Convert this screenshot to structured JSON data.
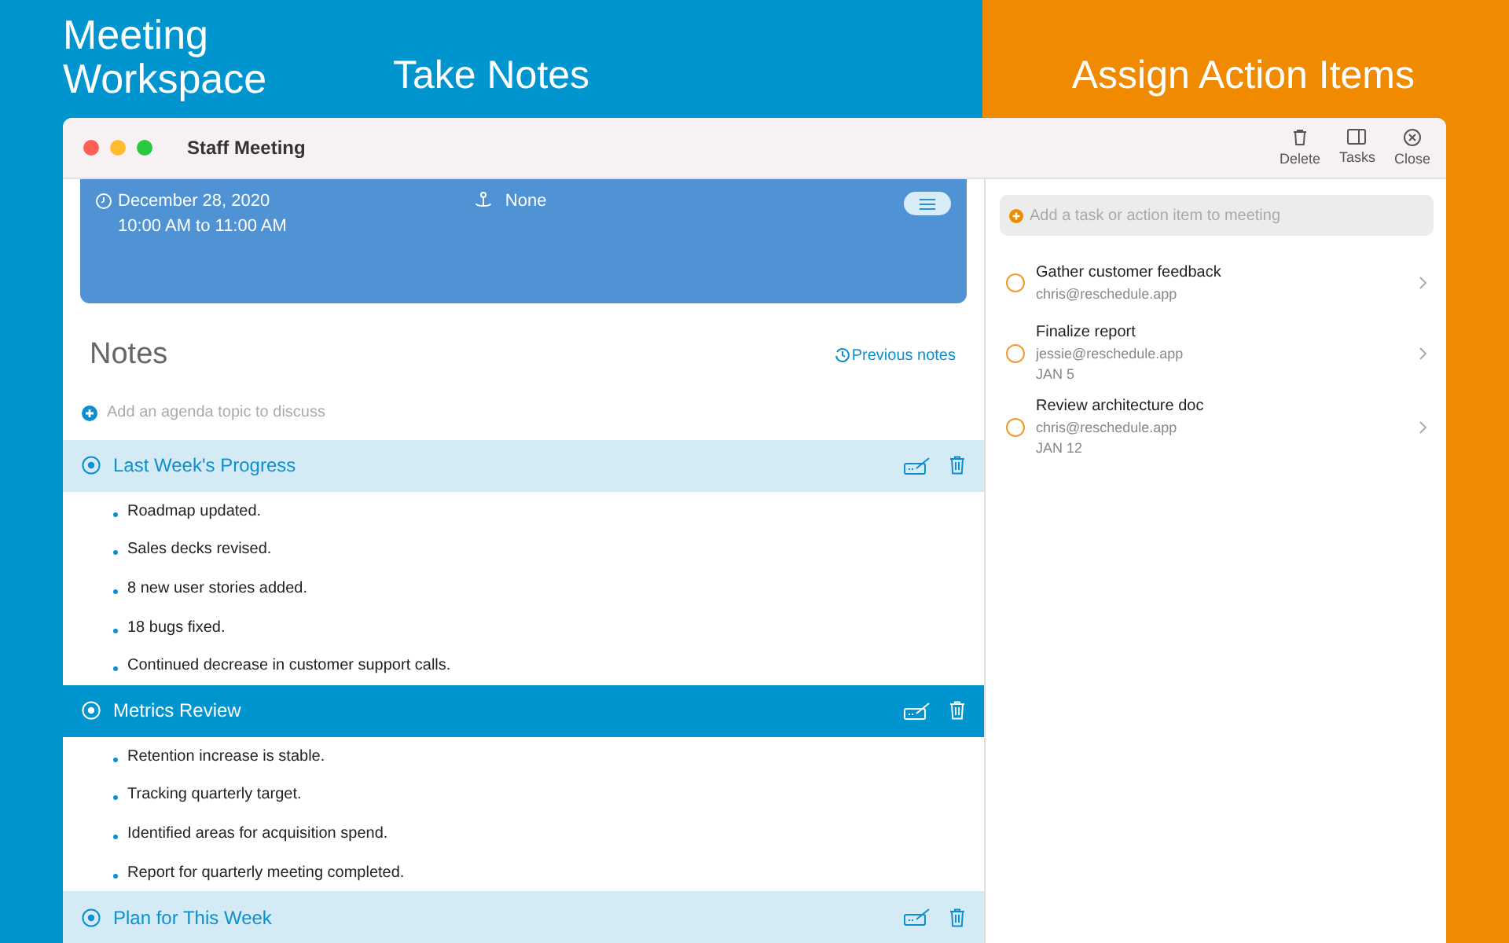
{
  "banner": {
    "app_title": "Meeting Workspace",
    "left_caption": "Take Notes",
    "right_caption": "Assign Action Items"
  },
  "window": {
    "title": "Staff Meeting",
    "toolbar": [
      {
        "kind": "delete",
        "label": "Delete"
      },
      {
        "kind": "tasks",
        "label": "Tasks"
      },
      {
        "kind": "close",
        "label": "Close"
      }
    ]
  },
  "event": {
    "date": "December 28, 2020",
    "time": "10:00 AM to 11:00 AM",
    "location": "None"
  },
  "notes": {
    "title": "Notes",
    "previous_link": "Previous notes",
    "agenda_placeholder": "Add an agenda topic to discuss",
    "topics": [
      {
        "title": "Last Week's Progress",
        "selected": false,
        "items": [
          "Roadmap updated.",
          "Sales decks revised.",
          "8 new user stories added.",
          "18 bugs fixed.",
          "Continued decrease in customer support calls."
        ]
      },
      {
        "title": "Metrics Review",
        "selected": true,
        "items": [
          "Retention increase is stable.",
          "Tracking quarterly target.",
          "Identified areas for acquisition spend.",
          "Report for quarterly meeting completed."
        ]
      },
      {
        "title": "Plan for This Week",
        "selected": false
      }
    ]
  },
  "tasks": {
    "placeholder": "Add a task or action item to meeting",
    "items": [
      {
        "title": "Gather customer feedback",
        "assignee": "chris@reschedule.app",
        "checked": false
      },
      {
        "title": "Finalize report",
        "assignee": "jessie@reschedule.app",
        "due": "JAN 5",
        "checked": false
      },
      {
        "title": "Review architecture doc",
        "assignee": "chris@reschedule.app",
        "due": "JAN 12",
        "checked": false
      }
    ]
  }
}
